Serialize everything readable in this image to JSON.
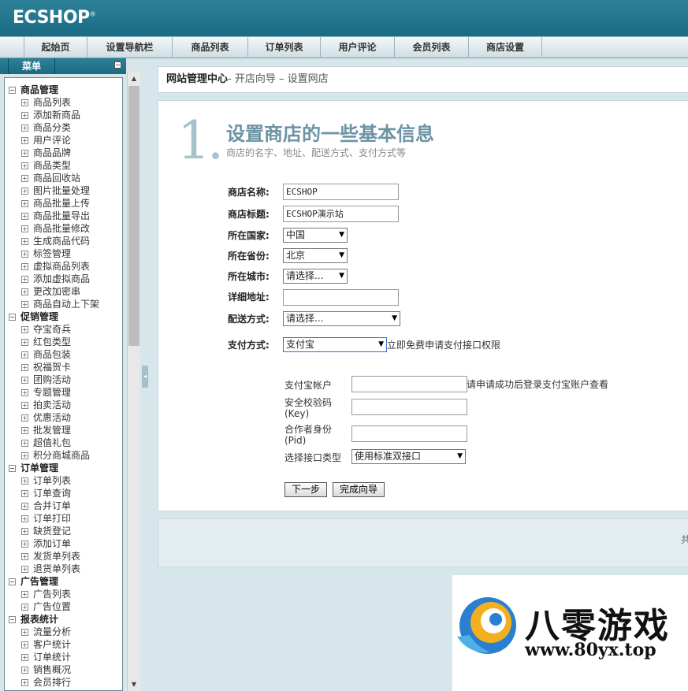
{
  "logo": {
    "text": "ECSHOP",
    "mark": "®"
  },
  "nav": {
    "items": [
      "起始页",
      "设置导航栏",
      "商品列表",
      "订单列表",
      "用户评论",
      "会员列表",
      "商店设置"
    ]
  },
  "sidebar": {
    "menu_label": "菜单",
    "collapse_symbol": "−",
    "tree": [
      {
        "type": "group",
        "label": "商品管理"
      },
      {
        "type": "item",
        "label": "商品列表"
      },
      {
        "type": "item",
        "label": "添加新商品"
      },
      {
        "type": "item",
        "label": "商品分类"
      },
      {
        "type": "item",
        "label": "用户评论"
      },
      {
        "type": "item",
        "label": "商品品牌"
      },
      {
        "type": "item",
        "label": "商品类型"
      },
      {
        "type": "item",
        "label": "商品回收站"
      },
      {
        "type": "item",
        "label": "图片批量处理"
      },
      {
        "type": "item",
        "label": "商品批量上传"
      },
      {
        "type": "item",
        "label": "商品批量导出"
      },
      {
        "type": "item",
        "label": "商品批量修改"
      },
      {
        "type": "item",
        "label": "生成商品代码"
      },
      {
        "type": "item",
        "label": "标签管理"
      },
      {
        "type": "item",
        "label": "虚拟商品列表"
      },
      {
        "type": "item",
        "label": "添加虚拟商品"
      },
      {
        "type": "item",
        "label": "更改加密串"
      },
      {
        "type": "item",
        "label": "商品自动上下架"
      },
      {
        "type": "group",
        "label": "促销管理"
      },
      {
        "type": "item",
        "label": "夺宝奇兵"
      },
      {
        "type": "item",
        "label": "红包类型"
      },
      {
        "type": "item",
        "label": "商品包装"
      },
      {
        "type": "item",
        "label": "祝福贺卡"
      },
      {
        "type": "item",
        "label": "团购活动"
      },
      {
        "type": "item",
        "label": "专题管理"
      },
      {
        "type": "item",
        "label": "拍卖活动"
      },
      {
        "type": "item",
        "label": "优惠活动"
      },
      {
        "type": "item",
        "label": "批发管理"
      },
      {
        "type": "item",
        "label": "超值礼包"
      },
      {
        "type": "item",
        "label": "积分商城商品"
      },
      {
        "type": "group",
        "label": "订单管理"
      },
      {
        "type": "item",
        "label": "订单列表"
      },
      {
        "type": "item",
        "label": "订单查询"
      },
      {
        "type": "item",
        "label": "合并订单"
      },
      {
        "type": "item",
        "label": "订单打印"
      },
      {
        "type": "item",
        "label": "缺货登记"
      },
      {
        "type": "item",
        "label": "添加订单"
      },
      {
        "type": "item",
        "label": "发货单列表"
      },
      {
        "type": "item",
        "label": "退货单列表"
      },
      {
        "type": "group",
        "label": "广告管理"
      },
      {
        "type": "item",
        "label": "广告列表"
      },
      {
        "type": "item",
        "label": "广告位置"
      },
      {
        "type": "group",
        "label": "报表统计"
      },
      {
        "type": "item",
        "label": "流量分析"
      },
      {
        "type": "item",
        "label": "客户统计"
      },
      {
        "type": "item",
        "label": "订单统计"
      },
      {
        "type": "item",
        "label": "销售概况"
      },
      {
        "type": "item",
        "label": "会员排行"
      }
    ]
  },
  "breadcrumb": {
    "main": "网站管理中心",
    "sub": "- 开店向导 – 设置网店"
  },
  "step": {
    "number": "1.",
    "title": "设置商店的一些基本信息",
    "desc": "商店的名字、地址、配送方式、支付方式等"
  },
  "form": {
    "shop_name": {
      "label": "商店名称:",
      "value": "ECSHOP"
    },
    "shop_title": {
      "label": "商店标题:",
      "value": "ECSHOP演示站"
    },
    "country": {
      "label": "所在国家:",
      "value": "中国"
    },
    "province": {
      "label": "所在省份:",
      "value": "北京"
    },
    "city": {
      "label": "所在城市:",
      "value": "请选择..."
    },
    "address": {
      "label": "详细地址:",
      "value": ""
    },
    "shipping": {
      "label": "配送方式:",
      "value": "请选择..."
    },
    "payment": {
      "label": "支付方式:",
      "value": "支付宝",
      "hint": "立即免费申请支付接口权限"
    },
    "alipay_account": {
      "label": "支付宝帐户",
      "value": "",
      "hint": "请申请成功后登录支付宝账户查看"
    },
    "security_code": {
      "label": "安全校验码",
      "label2": "(Key)",
      "value": ""
    },
    "partner_id": {
      "label": "合作者身份",
      "label2": "(Pid)",
      "value": ""
    },
    "interface_type": {
      "label": "选择接口类型",
      "value": "使用标准双接口"
    }
  },
  "buttons": {
    "next": "下一步",
    "finish": "完成向导"
  },
  "footer": {
    "text": "共"
  },
  "watermark": {
    "brand": "八零游戏",
    "url": "www.80yx.top"
  },
  "icons": {
    "dropdown": "▼",
    "scroll_up": "▲",
    "scroll_down": "▼",
    "split": "◂",
    "tree_box": "⊟",
    "tree_leaf": "⊡"
  }
}
